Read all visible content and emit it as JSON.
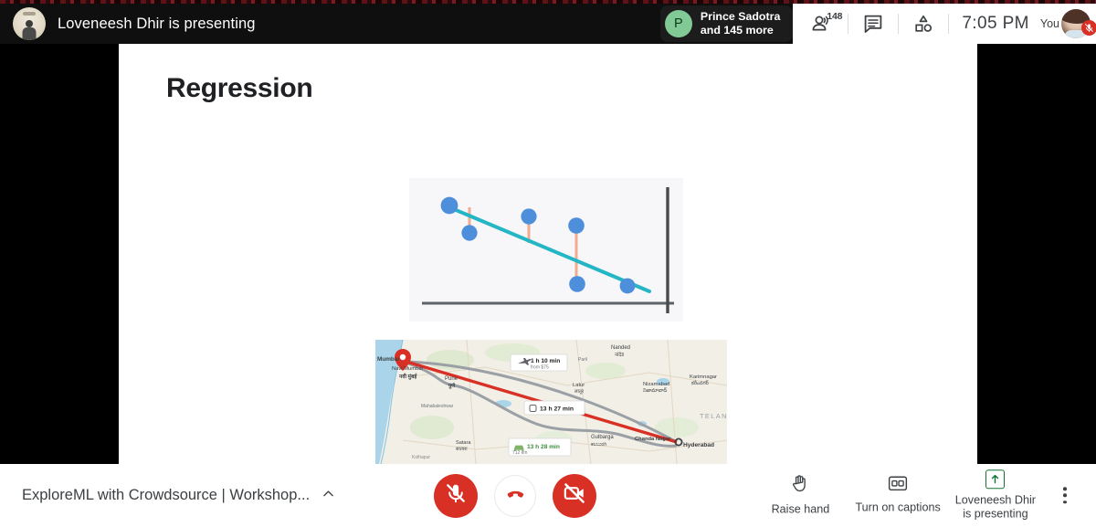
{
  "topbar": {
    "presenting_banner": "Loveneesh Dhir is presenting",
    "presenter_avatar_name": "presenter-avatar",
    "speaker": {
      "initial": "P",
      "name": "Prince Sadotra",
      "others": "and 145 more"
    },
    "participants": {
      "icon": "people-icon",
      "count": "148"
    },
    "chat": {
      "icon": "chat-icon"
    },
    "activities": {
      "icon": "activities-icon"
    },
    "clock": "7:05 PM",
    "self": {
      "label": "You",
      "muted": true,
      "mute_icon": "mic-off-icon"
    }
  },
  "slide": {
    "title": "Regression",
    "figures": {
      "chart_caption": "regression-scatter-figure",
      "map_caption": "route-map-figure"
    }
  },
  "chart_data": {
    "type": "scatter",
    "title": "Regression",
    "xlabel": "",
    "ylabel": "",
    "grid": false,
    "legend": null,
    "colors": {
      "point": "#4e8fdb",
      "fit_line": "#24b6c4",
      "residual": "#f0a98e",
      "axis": "#5f6368",
      "plot_bg": "#f7f6f8"
    },
    "series": [
      {
        "name": "observations",
        "points": [
          {
            "x": 0.14,
            "y": 0.82
          },
          {
            "x": 0.25,
            "y": 0.62
          },
          {
            "x": 0.49,
            "y": 0.69
          },
          {
            "x": 0.69,
            "y": 0.6
          },
          {
            "x": 0.7,
            "y": 0.22
          },
          {
            "x": 0.91,
            "y": 0.2
          }
        ]
      },
      {
        "name": "fit-line",
        "kind": "line",
        "points": [
          {
            "x": 0.16,
            "y": 0.79
          },
          {
            "x": 0.97,
            "y": 0.13
          }
        ]
      }
    ],
    "residuals": [
      {
        "x": 0.25,
        "y_point": 0.62,
        "y_line": 0.72
      },
      {
        "x": 0.49,
        "y_point": 0.69,
        "y_line": 0.53
      },
      {
        "x": 0.69,
        "y_point": 0.6,
        "y_line": 0.37
      },
      {
        "x": 0.7,
        "y_point": 0.22,
        "y_line": 0.36
      }
    ],
    "xlim": [
      0,
      1
    ],
    "ylim": [
      0,
      1
    ]
  },
  "map": {
    "origin": "Mumbai",
    "origin_sub": "Navi Mumbai",
    "origin_sub_native": "नवी मुंबई",
    "destination": "Hyderabad",
    "waypoints": [
      "Pune",
      "Satara",
      "Latur",
      "Nanded",
      "Nizamabad",
      "Gulbarga",
      "Chanda Nagar",
      "Karimnagar",
      "Mahabaleshwar",
      "TELAN"
    ],
    "labels": [
      {
        "mode": "flight-icon",
        "time": "1 h 10 min",
        "sub": "from $75"
      },
      {
        "mode": "train-icon",
        "time": "13 h 27 min",
        "sub": ""
      },
      {
        "mode": "car-icon",
        "time": "13 h 28 min",
        "sub": "712 km"
      }
    ],
    "route_color": "#d93025"
  },
  "bottombar": {
    "meeting_title": "ExploreML with Crowdsource | Workshop...",
    "expand_icon": "chevron-up-icon",
    "mic": {
      "icon": "mic-off-icon",
      "state": "muted"
    },
    "hangup": {
      "icon": "call-end-icon"
    },
    "camera": {
      "icon": "camera-off-icon",
      "state": "off"
    },
    "raise_hand": {
      "icon": "hand-icon",
      "label": "Raise hand"
    },
    "captions": {
      "icon": "cc-icon",
      "label": "Turn on captions"
    },
    "present": {
      "icon": "present-up-icon",
      "label_line1": "Loveneesh Dhir",
      "label_line2": "is presenting"
    },
    "more": {
      "icon": "more-vert-icon"
    }
  }
}
